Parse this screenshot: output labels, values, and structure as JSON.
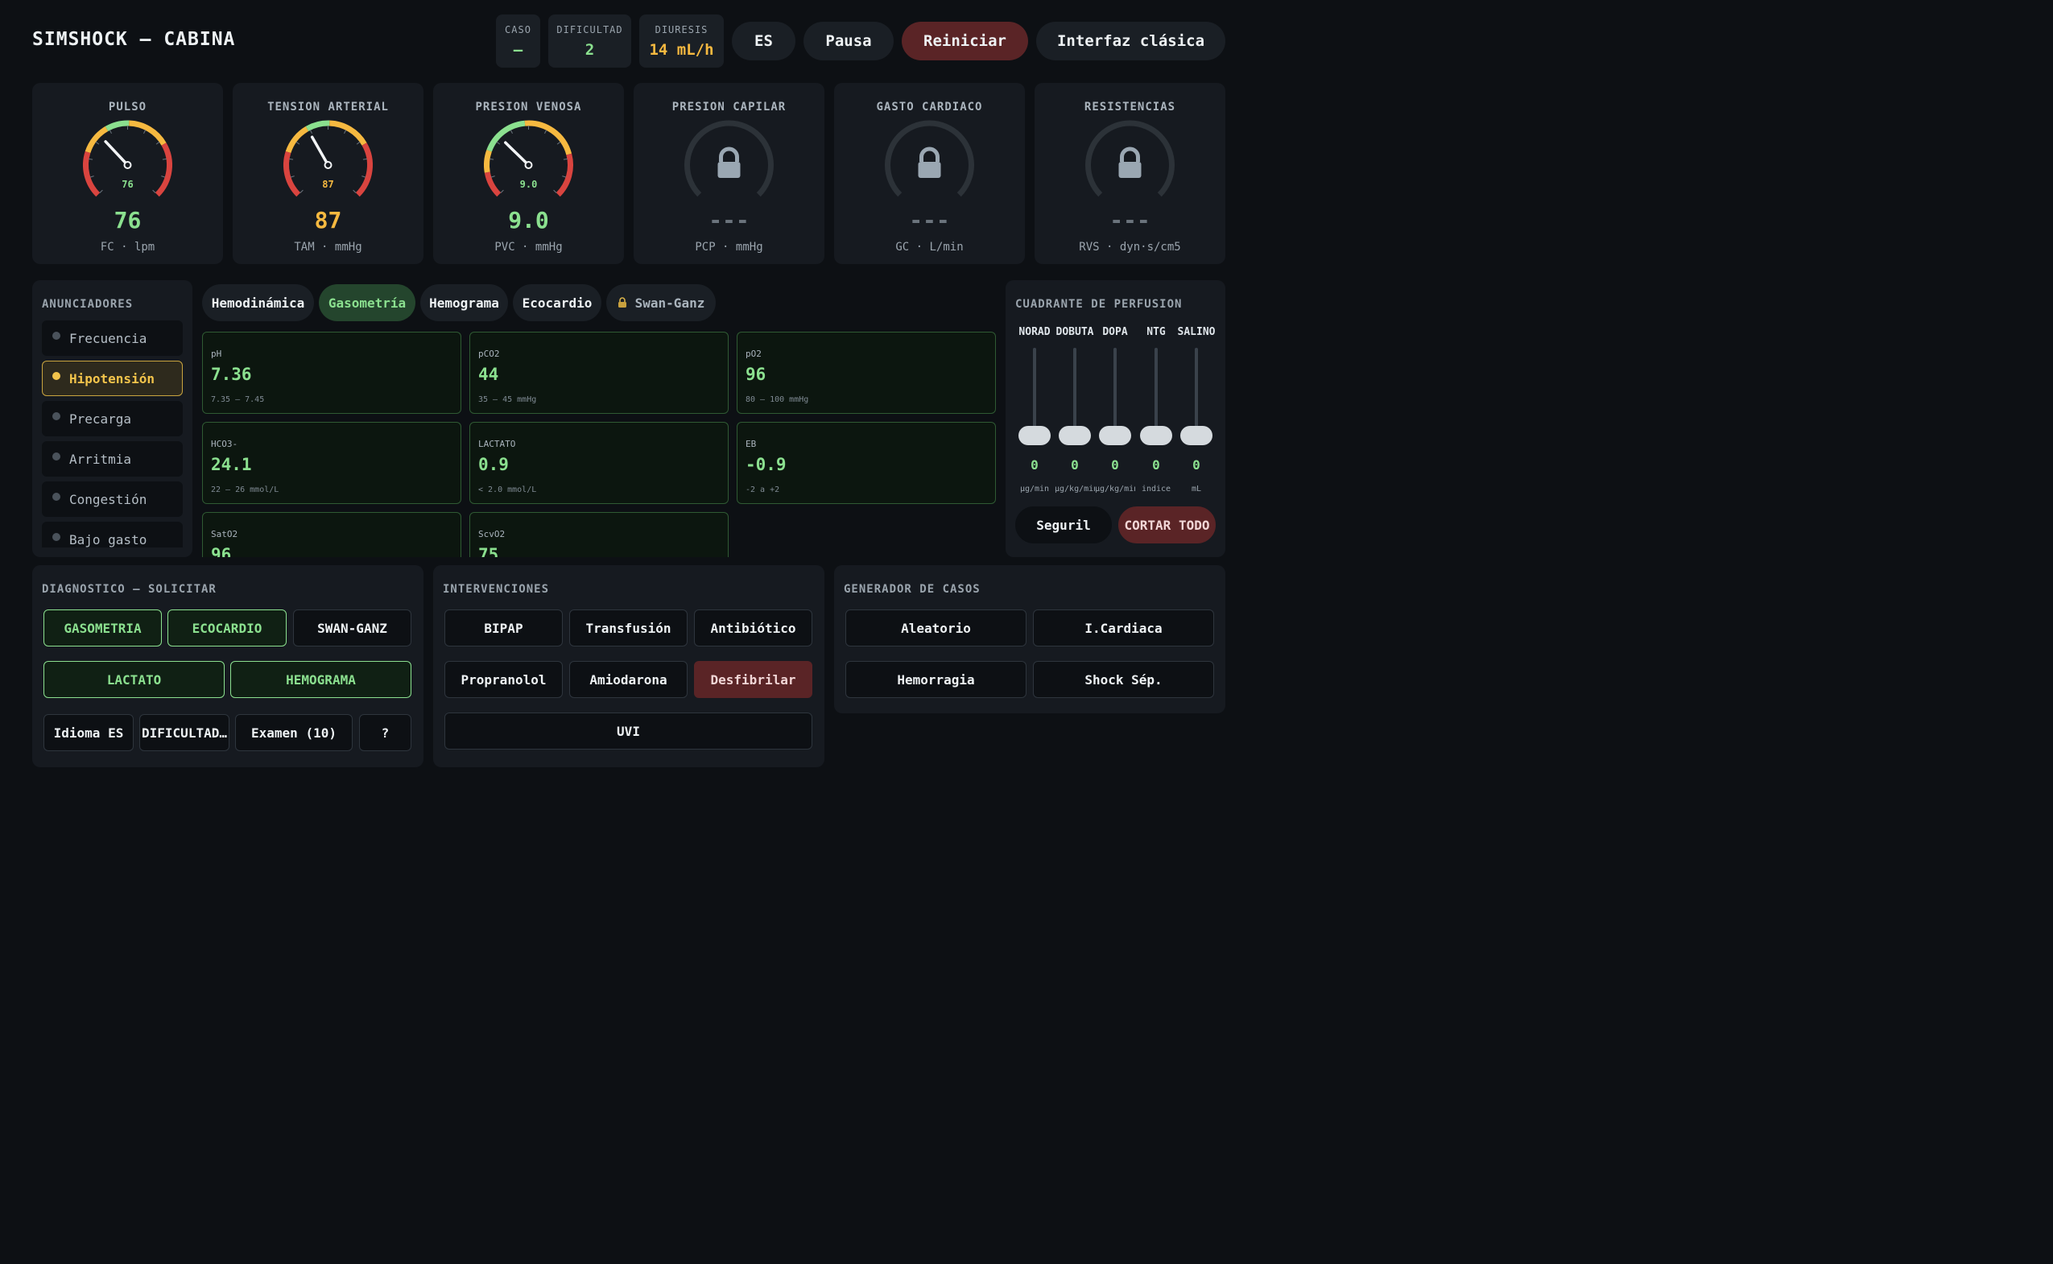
{
  "header": {
    "title": "SIMSHOCK — CABINA",
    "stats": [
      {
        "label": "CASO",
        "value": "—"
      },
      {
        "label": "DIFICULTAD",
        "value": "2"
      },
      {
        "label": "DIURESIS",
        "value": "14 mL/h"
      }
    ],
    "buttons": {
      "lang": "ES",
      "pause": "Pausa",
      "restart": "Reiniciar",
      "classic": "Interfaz clásica"
    }
  },
  "gauges": [
    {
      "title": "PULSO",
      "value": "76",
      "dial_value": "76",
      "unit": "FC · lpm",
      "locked": false,
      "needle_fraction": 0.34,
      "color": "#8be08f"
    },
    {
      "title": "TENSION ARTERIAL",
      "value": "87",
      "dial_value": "87",
      "unit": "TAM · mmHg",
      "locked": false,
      "needle_fraction": 0.39,
      "color": "#f6b940"
    },
    {
      "title": "PRESION VENOSA",
      "value": "9.0",
      "dial_value": "9.0",
      "unit": "PVC · mmHg",
      "locked": false,
      "needle_fraction": 0.33,
      "color": "#8be08f"
    },
    {
      "title": "PRESION CAPILAR",
      "value": "---",
      "dial_value": "",
      "unit": "PCP · mmHg",
      "locked": true,
      "color": "#6b747d"
    },
    {
      "title": "GASTO CARDIACO",
      "value": "---",
      "dial_value": "",
      "unit": "GC · L/min",
      "locked": true,
      "color": "#6b747d"
    },
    {
      "title": "RESISTENCIAS",
      "value": "---",
      "dial_value": "",
      "unit": "RVS · dyn·s/cm5",
      "locked": true,
      "color": "#6b747d"
    }
  ],
  "annunciators": {
    "title": "ANUNCIADORES",
    "items": [
      {
        "label": "Frecuencia",
        "active": false
      },
      {
        "label": "Hipotensión",
        "active": true
      },
      {
        "label": "Precarga",
        "active": false
      },
      {
        "label": "Arritmia",
        "active": false
      },
      {
        "label": "Congestión",
        "active": false
      },
      {
        "label": "Bajo gasto",
        "active": false
      }
    ]
  },
  "tabs": [
    {
      "label": "Hemodinámica",
      "active": false,
      "locked": false
    },
    {
      "label": "Gasometría",
      "active": true,
      "locked": false
    },
    {
      "label": "Hemograma",
      "active": false,
      "locked": false
    },
    {
      "label": "Ecocardio",
      "active": false,
      "locked": false
    },
    {
      "label": "Swan-Ganz",
      "active": false,
      "locked": true,
      "icon": "lock-icon"
    }
  ],
  "labs": [
    {
      "name": "pH",
      "value": "7.36",
      "range": "7.35 — 7.45"
    },
    {
      "name": "pCO2",
      "value": "44",
      "range": "35 — 45 mmHg"
    },
    {
      "name": "pO2",
      "value": "96",
      "range": "80 — 100 mmHg"
    },
    {
      "name": "HCO3-",
      "value": "24.1",
      "range": "22 — 26 mmol/L"
    },
    {
      "name": "LACTATO",
      "value": "0.9",
      "range": "< 2.0 mmol/L"
    },
    {
      "name": "EB",
      "value": "-0.9",
      "range": "-2 a +2"
    },
    {
      "name": "SatO2",
      "value": "96",
      "range": ""
    },
    {
      "name": "ScvO2",
      "value": "75",
      "range": ""
    }
  ],
  "perfusion": {
    "title": "CUADRANTE DE PERFUSION",
    "drugs": [
      {
        "name": "NORAD",
        "value": "0",
        "unit": "µg/min"
      },
      {
        "name": "DOBUTA",
        "value": "0",
        "unit": "µg/kg/min"
      },
      {
        "name": "DOPA",
        "value": "0",
        "unit": "µg/kg/min"
      },
      {
        "name": "NTG",
        "value": "0",
        "unit": "indice"
      },
      {
        "name": "SALINO",
        "value": "0",
        "unit": "mL"
      }
    ],
    "seguir": "Seguril",
    "cut_all": "CORTAR TODO"
  },
  "diagnostics": {
    "title": "DIAGNOSTICO — SOLICITAR",
    "row1": [
      {
        "label": "GASOMETRIA",
        "green": true
      },
      {
        "label": "ECOCARDIO",
        "green": true
      },
      {
        "label": "SWAN-GANZ",
        "green": false
      }
    ],
    "row2": [
      {
        "label": "LACTATO",
        "green": true
      },
      {
        "label": "HEMOGRAMA",
        "green": true
      }
    ],
    "row3": [
      "Idioma ES",
      "DIFICULTAD…",
      "Examen (10)",
      "?"
    ]
  },
  "interventions": {
    "title": "INTERVENCIONES",
    "items": [
      "BIPAP",
      "Transfusión",
      "Antibiótico",
      "Propranolol",
      "Amiodarona",
      "Desfibrilar",
      "UVI"
    ]
  },
  "generator": {
    "title": "GENERADOR DE CASOS",
    "items": [
      "Aleatorio",
      "I.Cardiaca",
      "Hemorragia",
      "Shock Sép."
    ]
  },
  "colors": {
    "accent_green": "#8be08f",
    "accent_amber": "#f6b940",
    "danger": "#5a2426",
    "bg": "#0d1014",
    "panel": "#161a20"
  }
}
